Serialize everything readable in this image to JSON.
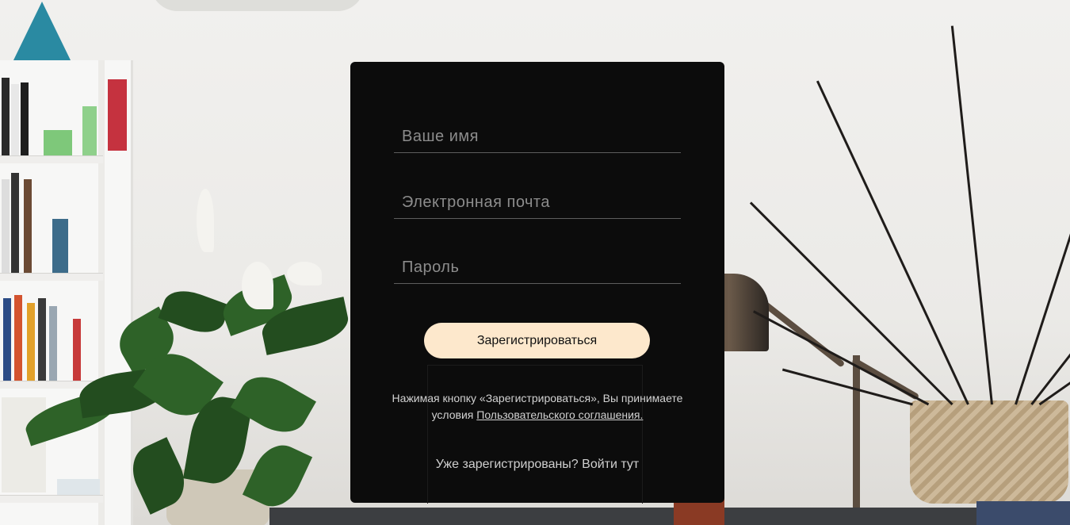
{
  "form": {
    "name_placeholder": "Ваше имя",
    "email_placeholder": "Электронная почта",
    "password_placeholder": "Пароль",
    "submit_label": "Зарегистрироваться",
    "consent_text": "Нажимая кнопку «Зарегистрироваться», Вы принимаете условия",
    "consent_link": "Пользовательского соглашения.",
    "login_text": "Уже зарегистрированы? Войти тут"
  },
  "colors": {
    "modal_bg": "#0c0c0c",
    "button_bg": "#fde8cc",
    "input_line": "#5d5d5d"
  }
}
